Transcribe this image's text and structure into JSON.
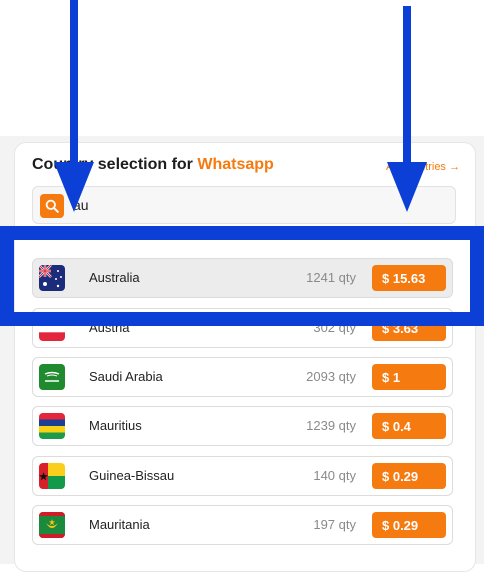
{
  "header": {
    "title_prefix": "Country selection for ",
    "title_service": "Whatsapp",
    "all_countries_link": "All countries →"
  },
  "search": {
    "value": "au",
    "icon": "search-icon"
  },
  "countries": [
    {
      "name": "Australia",
      "qty": "1241 qty",
      "price": "$ 15.63",
      "flag": "australia-flag-icon",
      "selected": true
    },
    {
      "name": "Austria",
      "qty": "302 qty",
      "price": "$ 3.63",
      "flag": "austria-flag-icon",
      "selected": false
    },
    {
      "name": "Saudi Arabia",
      "qty": "2093 qty",
      "price": "$ 1",
      "flag": "saudi-arabia-flag-icon",
      "selected": false
    },
    {
      "name": "Mauritius",
      "qty": "1239 qty",
      "price": "$ 0.4",
      "flag": "mauritius-flag-icon",
      "selected": false
    },
    {
      "name": "Guinea-Bissau",
      "qty": "140 qty",
      "price": "$ 0.29",
      "flag": "guinea-bissau-flag-icon",
      "selected": false
    },
    {
      "name": "Mauritania",
      "qty": "197 qty",
      "price": "$ 0.29",
      "flag": "mauritania-flag-icon",
      "selected": false
    }
  ],
  "colors": {
    "accent": "#f57a10",
    "annotation_blue": "#0b3fd6"
  }
}
